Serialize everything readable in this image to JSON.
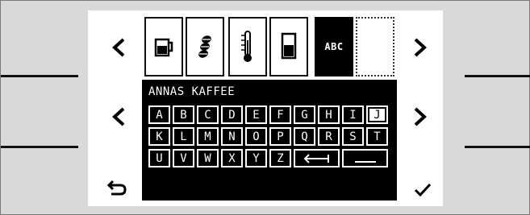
{
  "display": {
    "entry_text": "ANNAS KAFFEE"
  },
  "tabs": [
    {
      "name": "cup-icon"
    },
    {
      "name": "beans-icon"
    },
    {
      "name": "thermometer-icon"
    },
    {
      "name": "fill-level-icon"
    },
    {
      "label": "ABC",
      "active": true
    },
    {
      "name": "empty"
    }
  ],
  "keyboard": {
    "row1": [
      "A",
      "B",
      "C",
      "D",
      "E",
      "F",
      "G",
      "H",
      "I",
      "J"
    ],
    "row2": [
      "K",
      "L",
      "M",
      "N",
      "O",
      "P",
      "Q",
      "R",
      "S",
      "T"
    ],
    "row3": [
      "U",
      "V",
      "W",
      "X",
      "Y",
      "Z"
    ],
    "selected_key": "J"
  },
  "icons": {
    "back": "back-arrow-icon",
    "confirm": "checkmark-icon",
    "nav_left": "chevron-left-icon",
    "nav_right": "chevron-right-icon",
    "enter": "enter-arrow-icon",
    "space": "space-icon"
  }
}
